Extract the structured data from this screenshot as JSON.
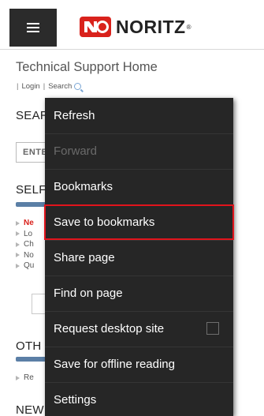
{
  "header": {
    "menu_icon": "hamburger-icon",
    "logo_icon": "noritz-logo-icon",
    "logo_text": "NORITZ",
    "logo_registered": "®"
  },
  "page": {
    "title": "Technical Support Home",
    "subnav": {
      "login": "Login",
      "search": "Search",
      "search_icon": "magnifier-icon"
    },
    "sections": {
      "search_heading": "SEAR",
      "search_input_value": "ENTE",
      "self_heading": "SELF",
      "self_items": [
        "Ne",
        "Lo",
        "Ch",
        "No",
        "Qu"
      ],
      "other_heading": "OTH",
      "other_items": [
        "Re"
      ],
      "news_heading": "NEW"
    }
  },
  "menu": {
    "items": [
      {
        "label": "Refresh"
      },
      {
        "label": "Forward"
      },
      {
        "label": "Bookmarks"
      },
      {
        "label": "Save to bookmarks"
      },
      {
        "label": "Share page"
      },
      {
        "label": "Find on page"
      },
      {
        "label": "Request desktop site"
      },
      {
        "label": "Save for offline reading"
      },
      {
        "label": "Settings"
      }
    ],
    "desktop_site_checked": false
  },
  "colors": {
    "menu_background": "#262626",
    "highlight_border": "#e1141c",
    "accent_bar": "#5b7fa6",
    "logo_red": "#d9221c"
  }
}
